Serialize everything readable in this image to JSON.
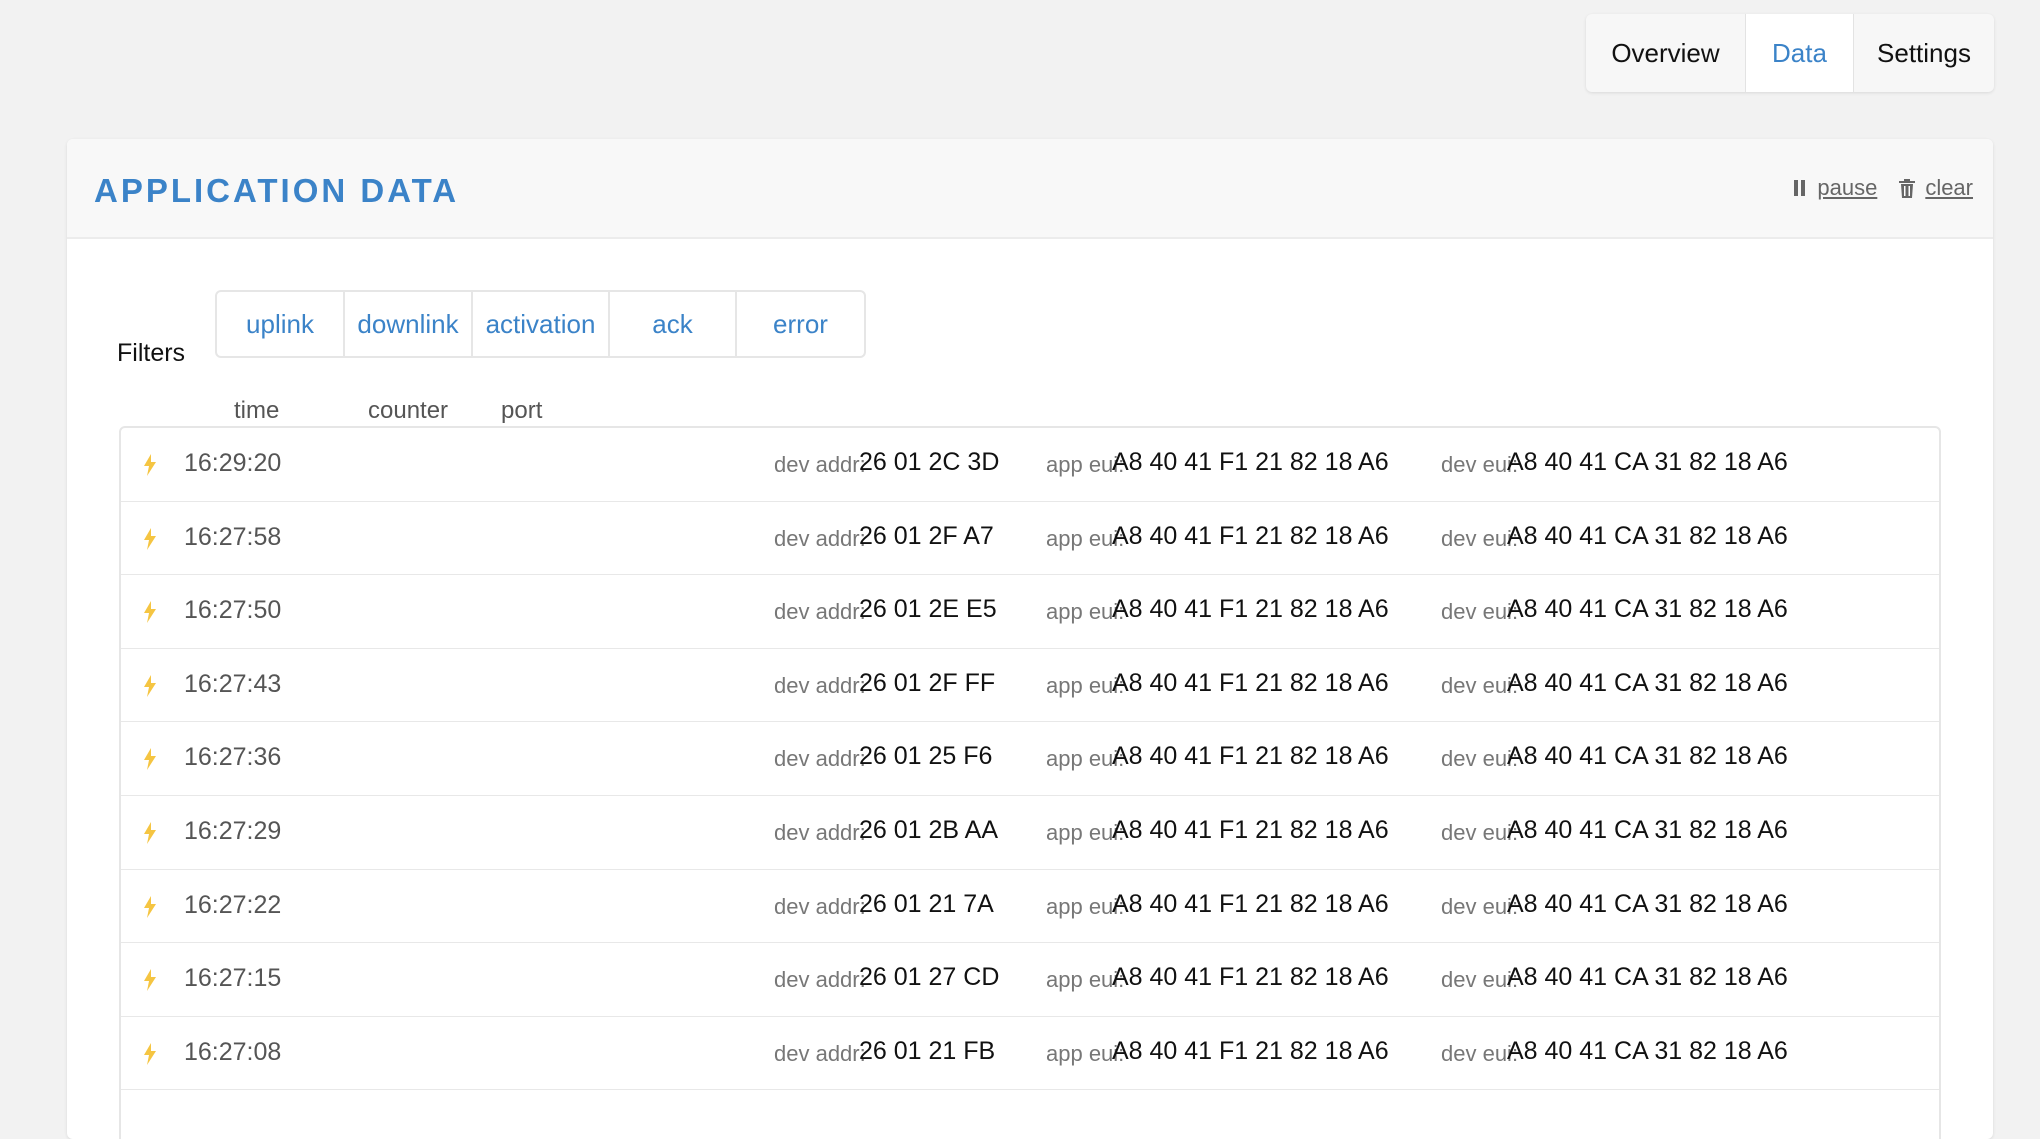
{
  "top_tabs": [
    {
      "label": "Overview",
      "active": false
    },
    {
      "label": "Data",
      "active": true
    },
    {
      "label": "Settings",
      "active": false
    }
  ],
  "panel": {
    "title": "APPLICATION DATA",
    "pause_label": "pause",
    "clear_label": "clear"
  },
  "filters": {
    "label": "Filters",
    "buttons": [
      "uplink",
      "downlink",
      "activation",
      "ack",
      "error"
    ]
  },
  "columns": {
    "time": "time",
    "counter": "counter",
    "port": "port"
  },
  "row_labels": {
    "dev_addr": "dev addr:",
    "app_eui": "app eui:",
    "dev_eui": "dev eui:"
  },
  "rows": [
    {
      "time": "16:29:20",
      "dev_addr": "26 01 2C 3D",
      "app_eui": "A8 40 41 F1 21 82 18 A6",
      "dev_eui": "A8 40 41 CA 31 82 18 A6"
    },
    {
      "time": "16:27:58",
      "dev_addr": "26 01 2F A7",
      "app_eui": "A8 40 41 F1 21 82 18 A6",
      "dev_eui": "A8 40 41 CA 31 82 18 A6"
    },
    {
      "time": "16:27:50",
      "dev_addr": "26 01 2E E5",
      "app_eui": "A8 40 41 F1 21 82 18 A6",
      "dev_eui": "A8 40 41 CA 31 82 18 A6"
    },
    {
      "time": "16:27:43",
      "dev_addr": "26 01 2F FF",
      "app_eui": "A8 40 41 F1 21 82 18 A6",
      "dev_eui": "A8 40 41 CA 31 82 18 A6"
    },
    {
      "time": "16:27:36",
      "dev_addr": "26 01 25 F6",
      "app_eui": "A8 40 41 F1 21 82 18 A6",
      "dev_eui": "A8 40 41 CA 31 82 18 A6"
    },
    {
      "time": "16:27:29",
      "dev_addr": "26 01 2B AA",
      "app_eui": "A8 40 41 F1 21 82 18 A6",
      "dev_eui": "A8 40 41 CA 31 82 18 A6"
    },
    {
      "time": "16:27:22",
      "dev_addr": "26 01 21 7A",
      "app_eui": "A8 40 41 F1 21 82 18 A6",
      "dev_eui": "A8 40 41 CA 31 82 18 A6"
    },
    {
      "time": "16:27:15",
      "dev_addr": "26 01 27 CD",
      "app_eui": "A8 40 41 F1 21 82 18 A6",
      "dev_eui": "A8 40 41 CA 31 82 18 A6"
    },
    {
      "time": "16:27:08",
      "dev_addr": "26 01 21 FB",
      "app_eui": "A8 40 41 F1 21 82 18 A6",
      "dev_eui": "A8 40 41 CA 31 82 18 A6"
    },
    {
      "time": "",
      "dev_addr": "",
      "app_eui": "",
      "dev_eui": ""
    }
  ],
  "colors": {
    "accent": "#3b83c8",
    "bolt": "#f5c542"
  },
  "icons": {
    "row_type": "lightning-bolt-icon",
    "pause": "pause-icon",
    "clear": "trash-icon"
  }
}
